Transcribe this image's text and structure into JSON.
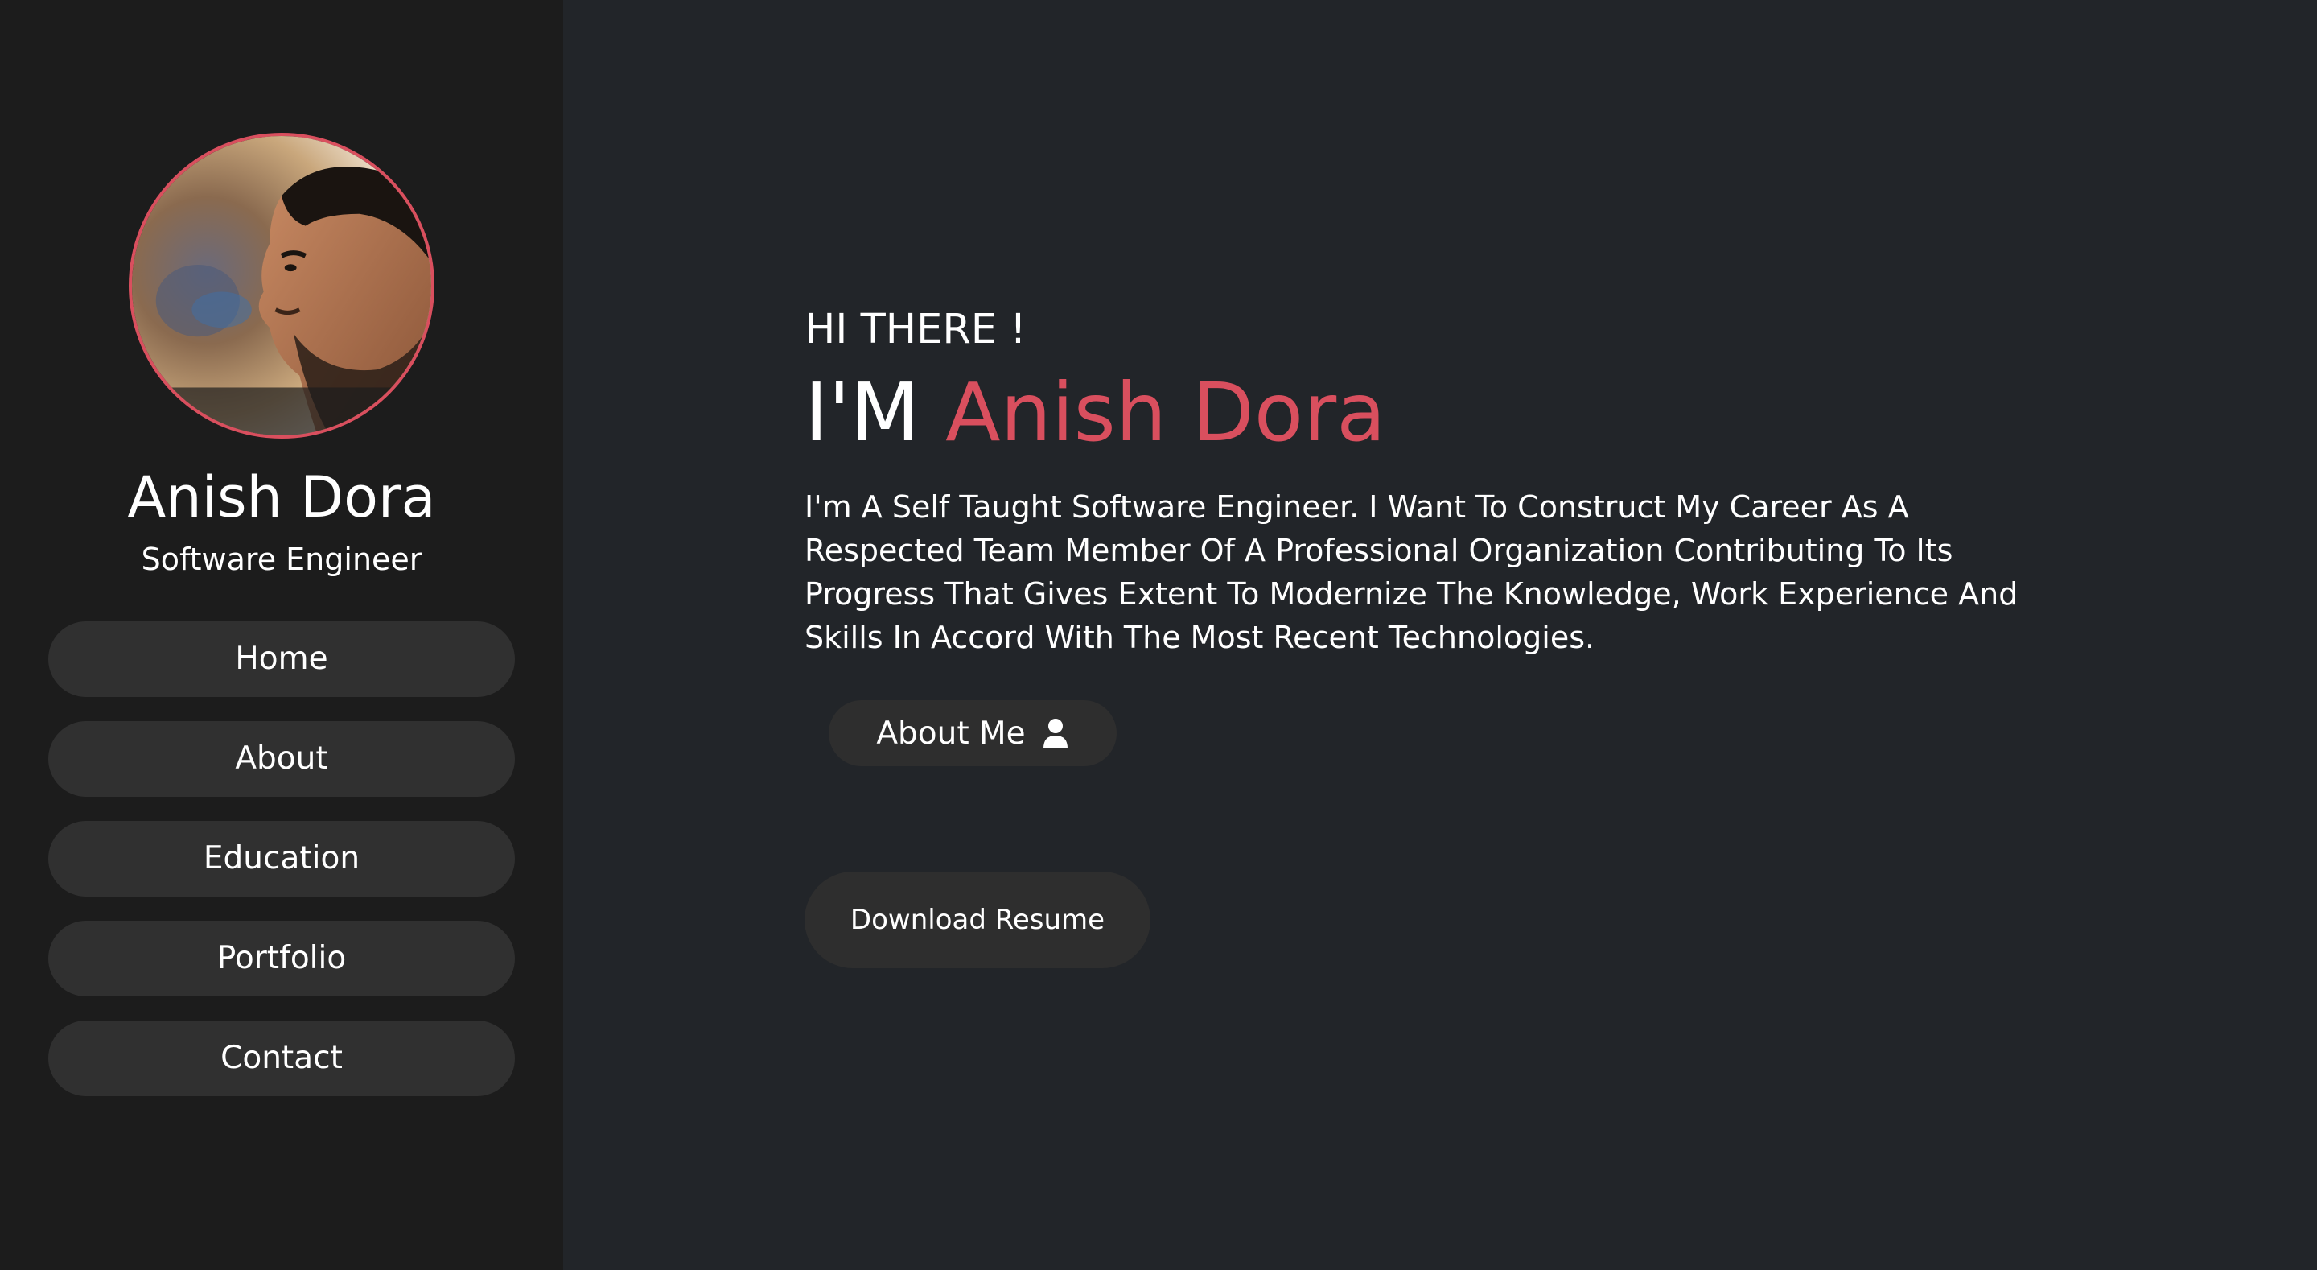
{
  "sidebar": {
    "profile": {
      "name": "Anish Dora",
      "role": "Software Engineer"
    },
    "nav": [
      {
        "label": "Home"
      },
      {
        "label": "About"
      },
      {
        "label": "Education"
      },
      {
        "label": "Portfolio"
      },
      {
        "label": "Contact"
      }
    ]
  },
  "hero": {
    "greeting": "HI THERE !",
    "headline_prefix": "I'M",
    "headline_name": "Anish Dora",
    "intro": "I'm A Self Taught Software Engineer. I Want To Construct My Career As A Respected Team Member Of A Professional Organization Contributing To Its Progress That Gives Extent To Modernize The Knowledge, Work Experience And Skills In Accord With The Most Recent Technologies.",
    "about_button": {
      "label": "About Me",
      "icon": "user-icon"
    },
    "resume_button": {
      "label": "Download Resume"
    }
  },
  "colors": {
    "accent": "#d94f5e",
    "sidebar_bg": "#1c1c1c",
    "main_bg": "#222529",
    "button_bg": "#303030"
  }
}
